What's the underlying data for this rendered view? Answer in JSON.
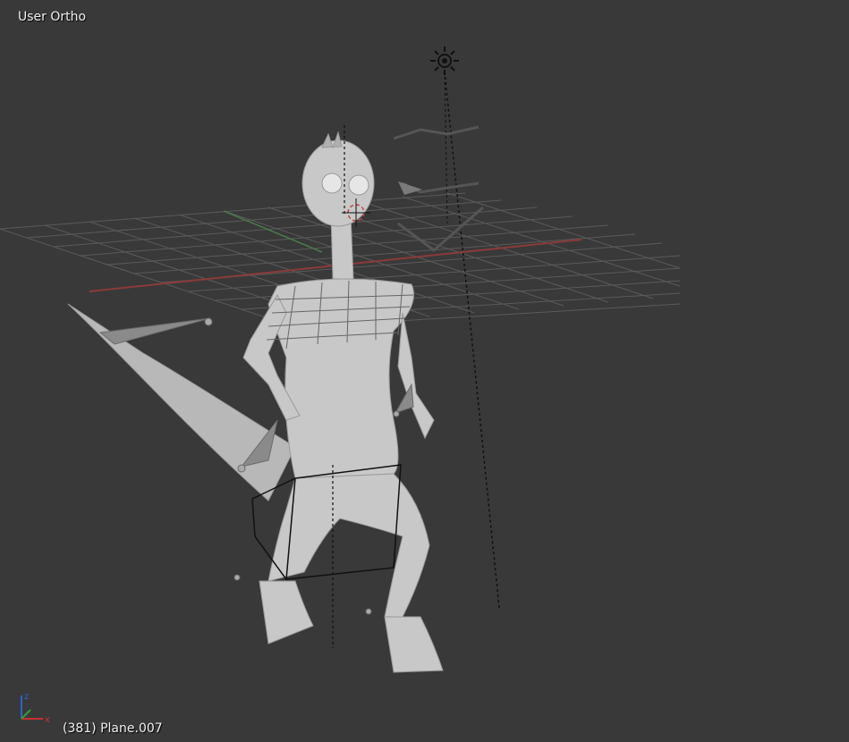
{
  "viewport": {
    "view_label": "User Ortho",
    "object_info": "(381) Plane.007",
    "background_color": "#393939"
  },
  "colors": {
    "grid": "#5a5a5a",
    "x_axis": "#8c3a3a",
    "y_axis": "#4a7a4a",
    "mesh": "#c8c8c8",
    "bone": "#9a9a9a",
    "gizmo_x": "#c83030",
    "gizmo_y": "#30a030",
    "gizmo_z": "#3060d0"
  },
  "icons": {
    "lamp": "lamp-icon",
    "cursor": "3d-cursor-icon",
    "camera": "camera-icon",
    "axis": "axis-gizmo-icon"
  }
}
